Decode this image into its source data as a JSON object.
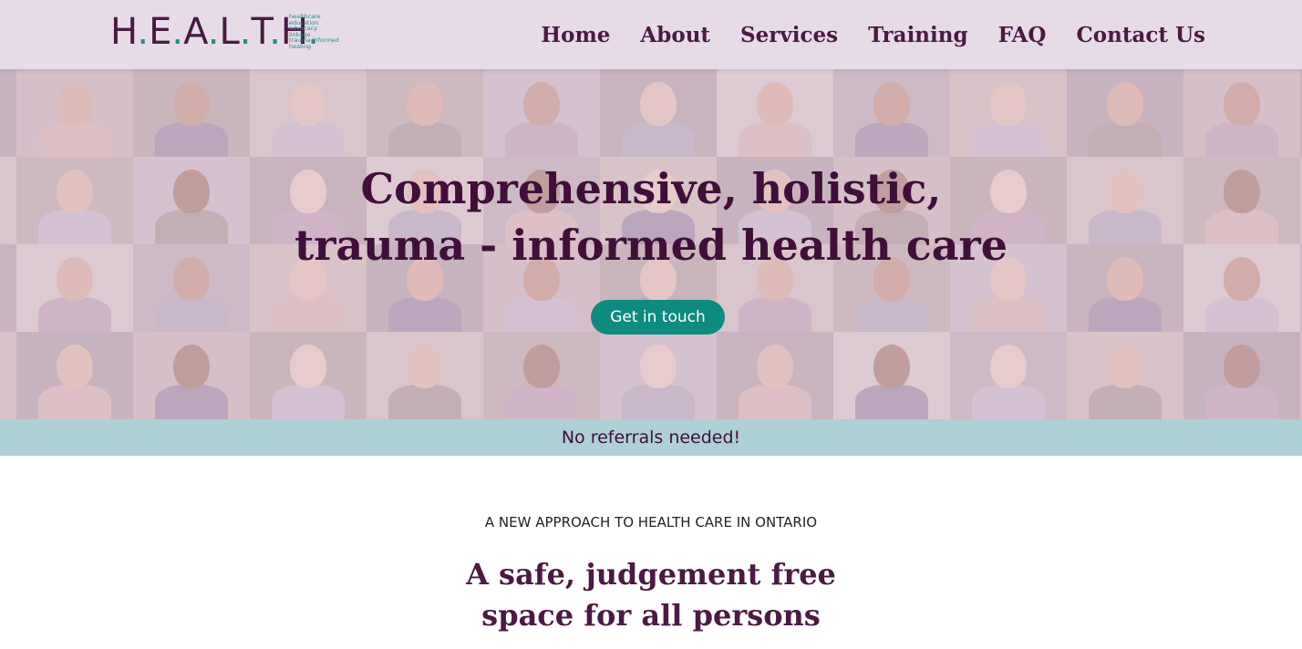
{
  "header": {
    "logo": {
      "letters": [
        "H",
        "E",
        "A",
        "L",
        "T",
        "H"
      ],
      "tagline": [
        "healthcare",
        "education",
        "advocacy",
        "linkage",
        "trauma informed",
        "healing"
      ],
      "brand_color": "#4a1a42",
      "accent_color": "#1f8f84"
    },
    "nav": [
      {
        "label": "Home"
      },
      {
        "label": "About"
      },
      {
        "label": "Services"
      },
      {
        "label": "Training"
      },
      {
        "label": "FAQ"
      },
      {
        "label": "Contact Us"
      }
    ]
  },
  "hero": {
    "title_lines": [
      "Comprehensive, holistic,",
      "trauma - informed health care"
    ],
    "cta_label": "Get in touch",
    "cta_color": "#0e8b7f"
  },
  "banner": {
    "text": "No referrals needed!",
    "background": "#aed0d7"
  },
  "intro": {
    "eyebrow": "A NEW APPROACH TO HEALTH CARE IN ONTARIO",
    "title_lines": [
      "A safe, judgement free",
      "space for all persons"
    ]
  }
}
